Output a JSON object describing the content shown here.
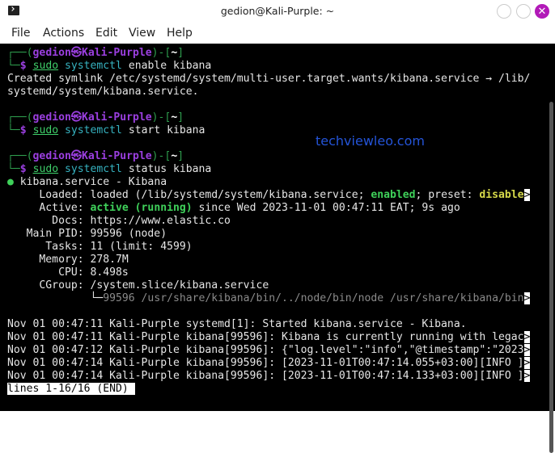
{
  "window": {
    "title": "gedion@Kali-Purple: ~",
    "close_glyph": "✕"
  },
  "menu": [
    "File",
    "Actions",
    "Edit",
    "View",
    "Help"
  ],
  "watermark": "techviewleo.com",
  "terminal_lines": [
    [
      [
        "┌──(",
        "g"
      ],
      [
        "gedion㉿Kali-Purple",
        "p"
      ],
      [
        ")-[",
        "g"
      ],
      [
        "~",
        "w"
      ],
      [
        "]",
        "g"
      ]
    ],
    [
      [
        "└─",
        "g"
      ],
      [
        "$ ",
        "p"
      ],
      [
        "sudo",
        "u"
      ],
      [
        " systemctl",
        "c"
      ],
      [
        " enable kibana",
        ""
      ]
    ],
    [
      [
        "Created symlink /etc/systemd/system/multi-user.target.wants/kibana.service → /lib/",
        ""
      ]
    ],
    [
      [
        "systemd/system/kibana.service.",
        ""
      ]
    ],
    [],
    [
      [
        "┌──(",
        "g"
      ],
      [
        "gedion㉿Kali-Purple",
        "p"
      ],
      [
        ")-[",
        "g"
      ],
      [
        "~",
        "w"
      ],
      [
        "]",
        "g"
      ]
    ],
    [
      [
        "└─",
        "g"
      ],
      [
        "$ ",
        "p"
      ],
      [
        "sudo",
        "u"
      ],
      [
        " systemctl",
        "c"
      ],
      [
        " start kibana",
        ""
      ]
    ],
    [],
    [
      [
        "┌──(",
        "g"
      ],
      [
        "gedion㉿Kali-Purple",
        "p"
      ],
      [
        ")-[",
        "g"
      ],
      [
        "~",
        "w"
      ],
      [
        "]",
        "g"
      ]
    ],
    [
      [
        "└─",
        "g"
      ],
      [
        "$ ",
        "p"
      ],
      [
        "sudo",
        "u"
      ],
      [
        " systemctl",
        "c"
      ],
      [
        " status kibana",
        ""
      ]
    ],
    [
      [
        "●",
        "dot"
      ],
      [
        " kibana.service - Kibana",
        ""
      ]
    ],
    [
      [
        "     Loaded: loaded (/lib/systemd/system/kibana.service; ",
        ""
      ],
      [
        "enabled",
        "bg"
      ],
      [
        "; preset: ",
        ""
      ],
      [
        "disable",
        "by"
      ],
      [
        ">",
        "inv"
      ]
    ],
    [
      [
        "     Active: ",
        ""
      ],
      [
        "active (running)",
        "bg"
      ],
      [
        " since Wed 2023-11-01 00:47:11 EAT; 9s ago",
        ""
      ]
    ],
    [
      [
        "       Docs: https://www.elastic.co",
        ""
      ]
    ],
    [
      [
        "   Main PID: 99596 (node)",
        ""
      ]
    ],
    [
      [
        "      Tasks: 11 (limit: 4599)",
        ""
      ]
    ],
    [
      [
        "     Memory: 278.7M",
        ""
      ]
    ],
    [
      [
        "        CPU: 8.498s",
        ""
      ]
    ],
    [
      [
        "     CGroup: /system.slice/kibana.service",
        ""
      ]
    ],
    [
      [
        "             └─",
        ""
      ],
      [
        "99596 /usr/share/kibana/bin/../node/bin/node /usr/share/kibana/bin",
        "dim"
      ],
      [
        ">",
        "inv"
      ]
    ],
    [],
    [
      [
        "Nov 01 00:47:11 Kali-Purple systemd[1]: Started kibana.service - Kibana.",
        ""
      ]
    ],
    [
      [
        "Nov 01 00:47:11 Kali-Purple kibana[99596]: Kibana is currently running with legac",
        ""
      ],
      [
        ">",
        "inv"
      ]
    ],
    [
      [
        "Nov 01 00:47:12 Kali-Purple kibana[99596]: {\"log.level\":\"info\",\"@timestamp\":\"2023",
        ""
      ],
      [
        ">",
        "inv"
      ]
    ],
    [
      [
        "Nov 01 00:47:14 Kali-Purple kibana[99596]: [2023-11-01T00:47:14.055+03:00][INFO ]",
        ""
      ],
      [
        ">",
        "inv"
      ]
    ],
    [
      [
        "Nov 01 00:47:14 Kali-Purple kibana[99596]: [2023-11-01T00:47:14.133+03:00][INFO ]",
        ""
      ],
      [
        ">",
        "inv"
      ]
    ],
    [
      [
        "lines 1-16/16 (END) ",
        "inv"
      ]
    ]
  ]
}
